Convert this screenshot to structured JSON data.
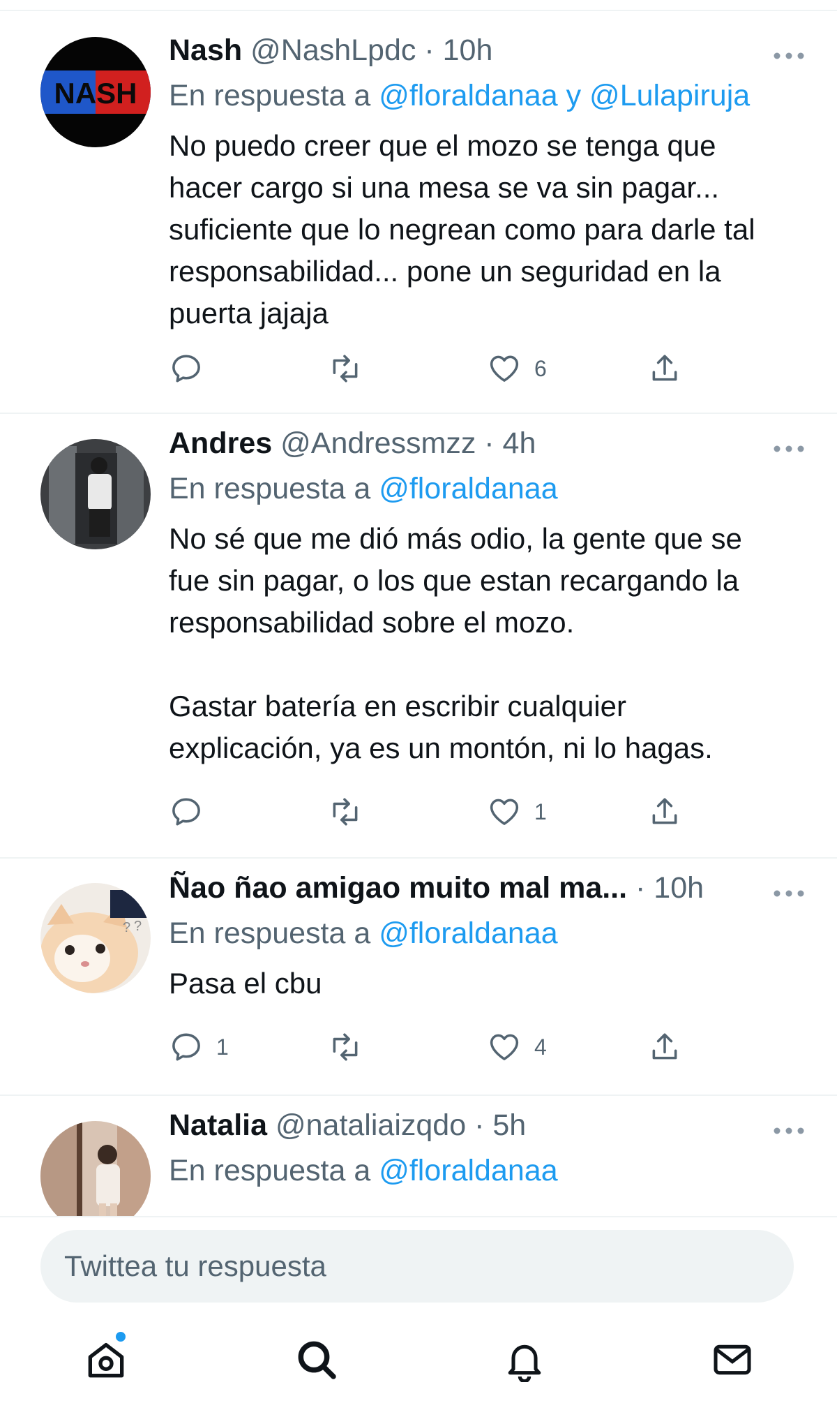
{
  "colors": {
    "accent": "#1d9bf0",
    "secondary_text": "#536471",
    "divider": "#eff3f4"
  },
  "reply_prefix": "En respuesta a",
  "tweets": [
    {
      "name": "Nash",
      "handle": "@NashLpdc",
      "time": "10h",
      "reply_to": [
        "@floraldanaa",
        "@Lulapiruja"
      ],
      "reply_joiner": "y",
      "text": "No puedo creer que el mozo se tenga que hacer cargo si una mesa se va sin pagar... suficiente que lo negrean como para darle tal responsabilidad... pone un seguridad en la puerta jajaja",
      "avatar_text": "NASH",
      "reply_count": "",
      "retweet_count": "",
      "like_count": "6"
    },
    {
      "name": "Andres",
      "handle": "@Andressmzz",
      "time": "4h",
      "reply_to": [
        "@floraldanaa"
      ],
      "text": "No sé que me dió más odio, la gente que se fue sin pagar, o los que estan recargando la responsabilidad sobre el mozo.\n\nGastar batería en escribir cualquier explicación, ya es un montón, ni lo hagas.",
      "reply_count": "",
      "retweet_count": "",
      "like_count": "1"
    },
    {
      "name": "Ñao ñao amigao muito mal ma...",
      "handle": "",
      "time": "10h",
      "reply_to": [
        "@floraldanaa"
      ],
      "text": "Pasa el cbu",
      "reply_count": "1",
      "retweet_count": "",
      "like_count": "4"
    },
    {
      "name": "Natalia",
      "handle": "@nataliaizqdo",
      "time": "5h",
      "reply_to": [
        "@floraldanaa"
      ]
    }
  ],
  "composer": {
    "placeholder": "Twittea tu respuesta"
  },
  "tabs": [
    {
      "icon": "home-icon",
      "has_notification_dot": true
    },
    {
      "icon": "search-icon"
    },
    {
      "icon": "bell-icon"
    },
    {
      "icon": "mail-icon"
    }
  ]
}
